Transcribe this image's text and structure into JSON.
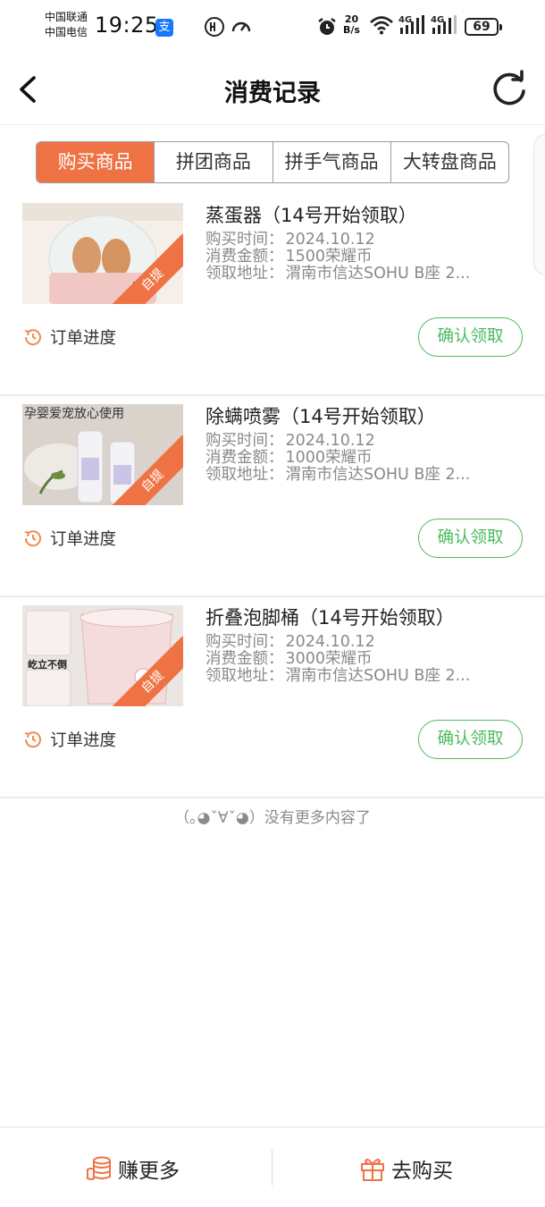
{
  "status_bar": {
    "carrier_1": "中国联通",
    "carrier_2": "中国电信",
    "time": "19:25",
    "app_badge": "支",
    "net_speed_value": "20",
    "net_speed_unit": "B/s",
    "signal_1_label": "4G",
    "signal_2_label": "4G",
    "battery": "69"
  },
  "header": {
    "title": "消费记录"
  },
  "tabs": [
    {
      "label": "购买商品",
      "active": true
    },
    {
      "label": "拼团商品",
      "active": false
    },
    {
      "label": "拼手气商品",
      "active": false
    },
    {
      "label": "大转盘商品",
      "active": false
    }
  ],
  "orders": [
    {
      "title": "蒸蛋器（14号开始领取）",
      "time_label": "购买时间：",
      "time_value": "2024.10.12",
      "amount_label": "消费金额：",
      "amount_value": "1500荣耀币",
      "address_label": "领取地址：",
      "address_value": "渭南市信达SOHU B座 2...",
      "ribbon": "自提",
      "progress_label": "订单进度",
      "confirm_label": "确认领取"
    },
    {
      "title": "除螨喷雾（14号开始领取）",
      "time_label": "购买时间：",
      "time_value": "2024.10.12",
      "amount_label": "消费金额：",
      "amount_value": "1000荣耀币",
      "address_label": "领取地址：",
      "address_value": "渭南市信达SOHU B座 2...",
      "ribbon": "自提",
      "thumb_caption": "孕婴爱宠放心使用",
      "progress_label": "订单进度",
      "confirm_label": "确认领取"
    },
    {
      "title": "折叠泡脚桶（14号开始领取）",
      "time_label": "购买时间：",
      "time_value": "2024.10.12",
      "amount_label": "消费金额：",
      "amount_value": "3000荣耀币",
      "address_label": "领取地址：",
      "address_value": "渭南市信达SOHU B座 2...",
      "ribbon": "自提",
      "thumb_caption": "屹立不倒",
      "progress_label": "订单进度",
      "confirm_label": "确认领取"
    }
  ],
  "footer_text": "（｡◕ˇ∀ˇ◕）没有更多内容了",
  "bottom_bar": {
    "earn_label": "赚更多",
    "buy_label": "去购买"
  },
  "colors": {
    "accent": "#ef7244",
    "confirm_green": "#4cba5e",
    "meta_gray": "#8a8a8a"
  }
}
